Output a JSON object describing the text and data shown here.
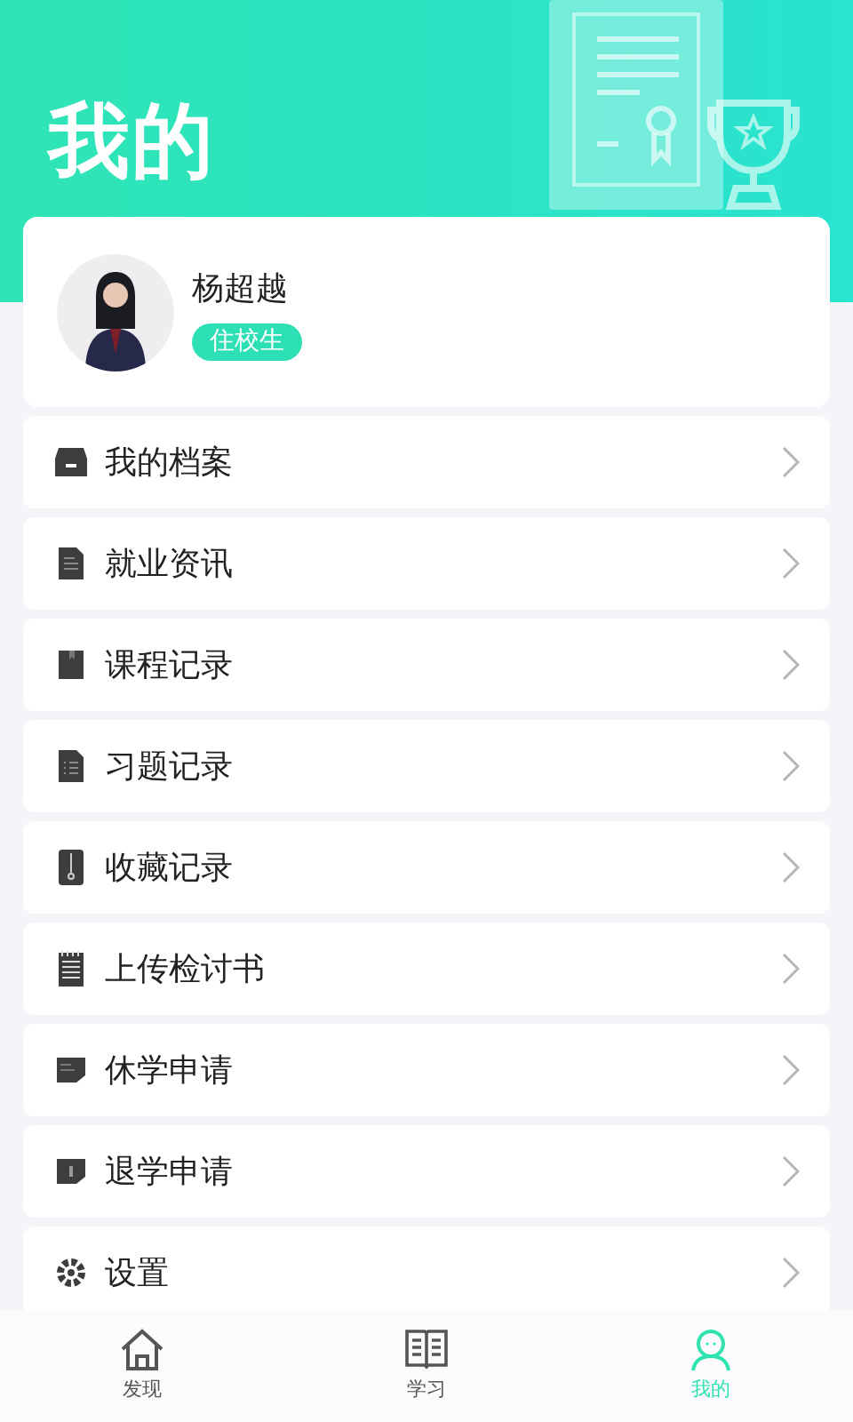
{
  "header": {
    "title": "我的"
  },
  "profile": {
    "name": "杨超越",
    "badge": "住校生"
  },
  "menu": [
    {
      "label": "我的档案"
    },
    {
      "label": "就业资讯"
    },
    {
      "label": "课程记录"
    },
    {
      "label": "习题记录"
    },
    {
      "label": "收藏记录"
    },
    {
      "label": "上传检讨书"
    },
    {
      "label": "休学申请"
    },
    {
      "label": "退学申请"
    },
    {
      "label": "设置"
    }
  ],
  "tabs": [
    {
      "label": "发现",
      "selected": false
    },
    {
      "label": "学习",
      "selected": false
    },
    {
      "label": "我的",
      "selected": true
    }
  ]
}
